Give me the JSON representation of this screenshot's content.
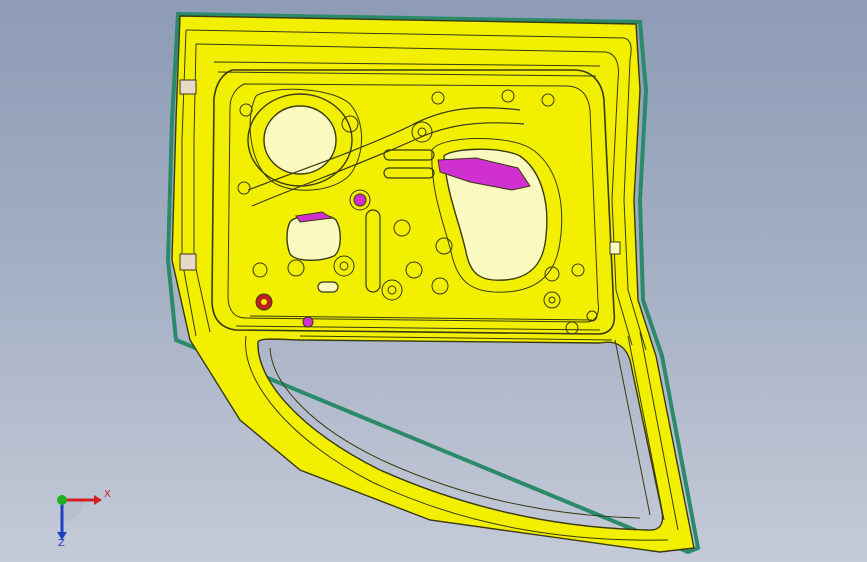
{
  "viewport": {
    "background_top": "#8d9bb6",
    "background_bottom": "#c4cad8"
  },
  "part": {
    "surface_color": "#f2f000",
    "edge_color": "#3a3a10",
    "hole_fill_color": "#fafac0",
    "highlight_color": "#d030d0",
    "flange_color": "#2a8a6a"
  },
  "triad": {
    "x_label": "X",
    "z_label": "Z",
    "x_color": "#d02020",
    "y_color": "#20b020",
    "z_color": "#2040c0"
  }
}
